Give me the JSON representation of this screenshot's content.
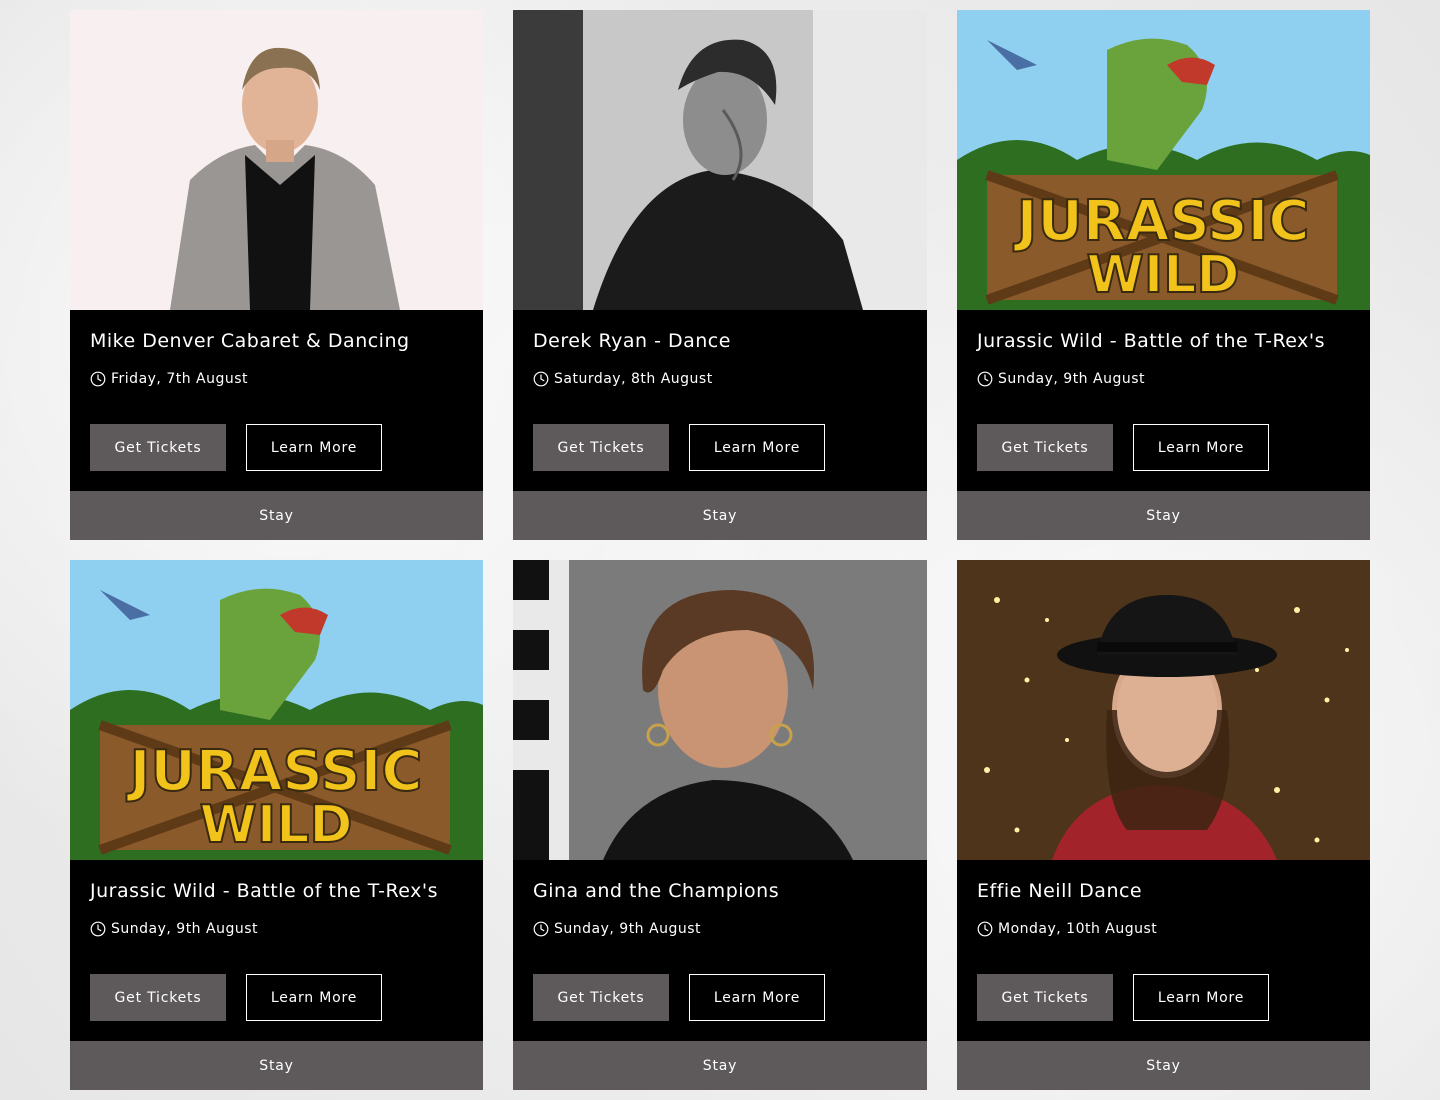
{
  "events": [
    {
      "title": "Mike Denver Cabaret & Dancing",
      "date": "Friday, 7th August",
      "primary_label": "Get Tickets",
      "secondary_label": "Learn More",
      "stay_label": "Stay",
      "image": "mike-denver-photo"
    },
    {
      "title": "Derek Ryan - Dance",
      "date": "Saturday, 8th August",
      "primary_label": "Get Tickets",
      "secondary_label": "Learn More",
      "stay_label": "Stay",
      "image": "derek-ryan-photo"
    },
    {
      "title": "Jurassic Wild - Battle of the T-Rex's",
      "date": "Sunday, 9th August",
      "primary_label": "Get Tickets",
      "secondary_label": "Learn More",
      "stay_label": "Stay",
      "image": "jurassic-wild-poster",
      "image_text": [
        "JURASSIC",
        "WILD"
      ]
    },
    {
      "title": "Jurassic Wild - Battle of the T-Rex's",
      "date": "Sunday, 9th August",
      "primary_label": "Get Tickets",
      "secondary_label": "Learn More",
      "stay_label": "Stay",
      "image": "jurassic-wild-poster",
      "image_text": [
        "JURASSIC",
        "WILD"
      ]
    },
    {
      "title": "Gina and the Champions",
      "date": "Sunday, 9th August",
      "primary_label": "Get Tickets",
      "secondary_label": "Learn More",
      "stay_label": "Stay",
      "image": "gina-photo"
    },
    {
      "title": "Effie Neill Dance",
      "date": "Monday, 10th August",
      "primary_label": "Get Tickets",
      "secondary_label": "Learn More",
      "stay_label": "Stay",
      "image": "effie-neill-photo"
    }
  ],
  "colors": {
    "card_bg": "#000000",
    "button_gray": "#5e5a5b",
    "text": "#ffffff"
  },
  "icons": {
    "date": "clock-icon"
  }
}
